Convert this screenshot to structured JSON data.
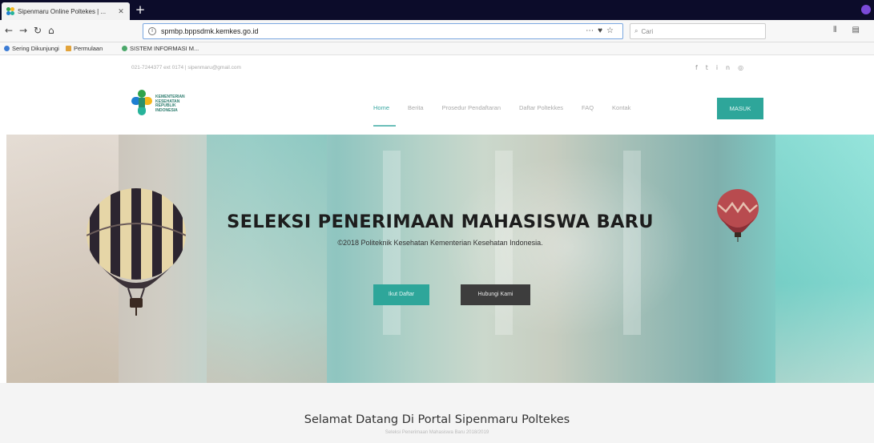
{
  "browser": {
    "tab_title": "Sipenmaru Online Poltekes | ...",
    "url": "spmbp.bppsdmk.kemkes.go.id",
    "search_placeholder": "Cari",
    "bookmarks": [
      {
        "label": "Sering Dikunjungi",
        "color": "#3b7bd4"
      },
      {
        "label": "Permulaan",
        "color": "#e2a33a"
      },
      {
        "label": "SISTEM INFORMASI M...",
        "color": "#4ca86b"
      }
    ]
  },
  "site": {
    "contact": "021-7244377 ext 0174  |  sipenmaru@gmail.com",
    "logo_text": [
      "KEMENTERIAN",
      "KESEHATAN",
      "REPUBLIK",
      "INDONESIA"
    ],
    "menu": [
      "Home",
      "Berita",
      "Prosedur Pendaftaran",
      "Daftar Poltekkes",
      "FAQ",
      "Kontak"
    ],
    "login_button": "MASUK",
    "hero": {
      "title": "SELEKSI PENERIMAAN MAHASISWA BARU",
      "subtitle": "©2018 Politeknik Kesehatan Kementerian Kesehatan Indonesia.",
      "register_button": "Ikut Daftar",
      "contact_button": "Hubungi Kami"
    },
    "welcome": {
      "title": "Selamat Datang Di Portal Sipenmaru Poltekes",
      "subtitle": "Seleksi Penerimaan Mahasiswa Baru 2018/2019"
    }
  },
  "colors": {
    "accent": "#2ea69a",
    "dark_button": "#3d3d3d",
    "chrome_tabbar": "#0c0c2a"
  }
}
